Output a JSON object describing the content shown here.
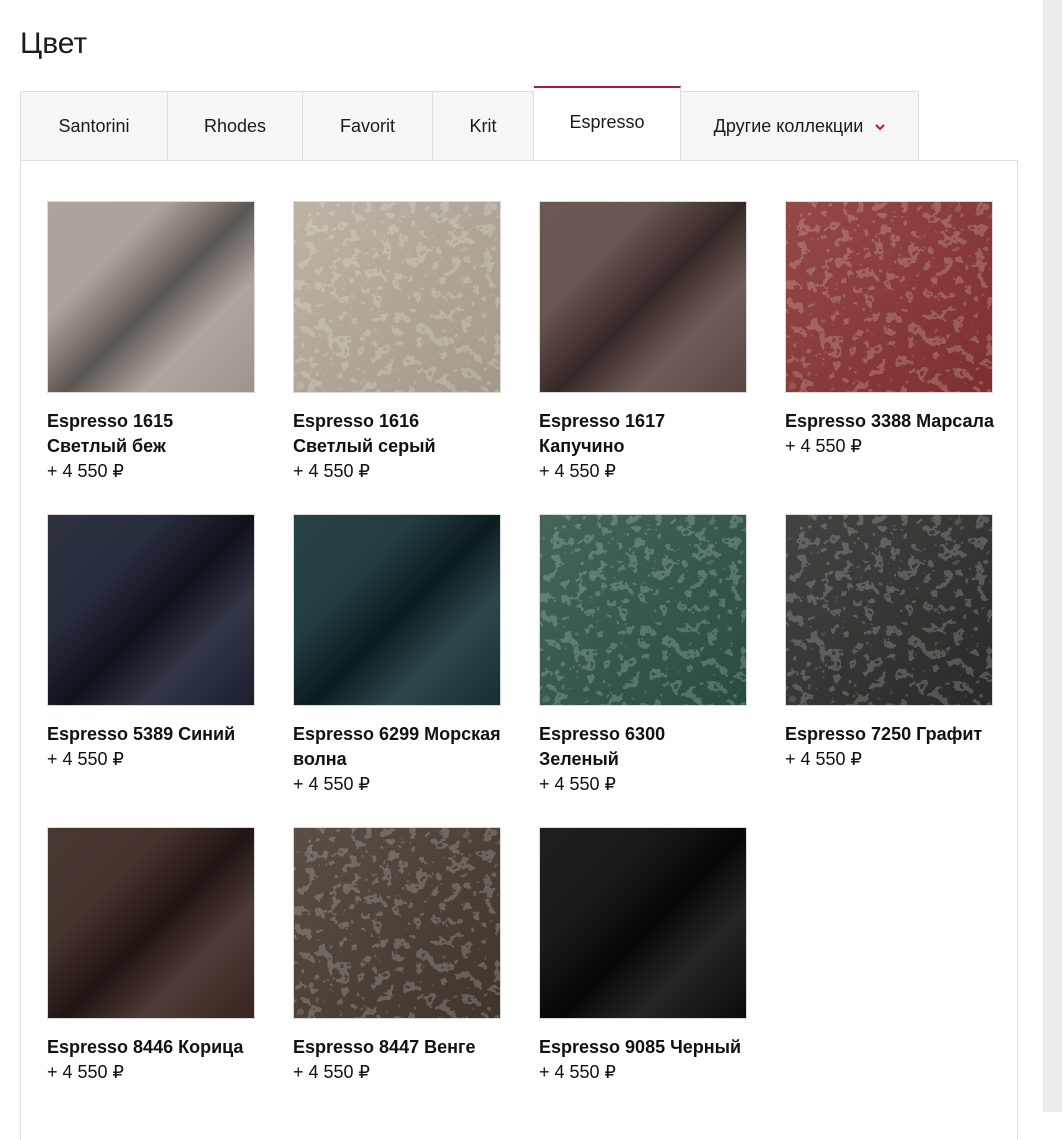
{
  "page": {
    "title": "Цвет"
  },
  "tabs": [
    {
      "label": "Santorini",
      "active": false
    },
    {
      "label": "Rhodes",
      "active": false
    },
    {
      "label": "Favorit",
      "active": false
    },
    {
      "label": "Krit",
      "active": false
    },
    {
      "label": "Espresso",
      "active": true
    },
    {
      "label": "Другие коллекции",
      "active": false,
      "dropdown": true
    }
  ],
  "accent_color": "#b5134b",
  "items": [
    {
      "name": "Espresso 1615 Светлый беж",
      "price": "+ 4 550 ₽",
      "color": "#a69c95",
      "textured": false
    },
    {
      "name": "Espresso 1616 Светлый серый",
      "price": "+ 4 550 ₽",
      "color": "#b6ab9b",
      "textured": true
    },
    {
      "name": "Espresso 1617 Капучино",
      "price": "+ 4 550 ₽",
      "color": "#5f4a46",
      "textured": false
    },
    {
      "name": "Espresso 3388 Марсала",
      "price": "+ 4 550 ₽",
      "color": "#8a3532",
      "textured": true
    },
    {
      "name": "Espresso 5389 Синий",
      "price": "+ 4 550 ₽",
      "color": "#1b2030",
      "textured": false
    },
    {
      "name": "Espresso 6299 Морская волна",
      "price": "+ 4 550 ₽",
      "color": "#153237",
      "textured": false
    },
    {
      "name": "Espresso 6300 Зеленый",
      "price": "+ 4 550 ₽",
      "color": "#2f5545",
      "textured": true
    },
    {
      "name": "Espresso 7250 Графит",
      "price": "+ 4 550 ₽",
      "color": "#2e2f2b",
      "textured": true
    },
    {
      "name": "Espresso 8446 Корица",
      "price": "+ 4 550 ₽",
      "color": "#3a2621",
      "textured": false
    },
    {
      "name": "Espresso 8447 Венге",
      "price": "+ 4 550 ₽",
      "color": "#473b32",
      "textured": true
    },
    {
      "name": "Espresso 9085 Черный",
      "price": "+ 4 550 ₽",
      "color": "#0c0c0c",
      "textured": false
    }
  ]
}
